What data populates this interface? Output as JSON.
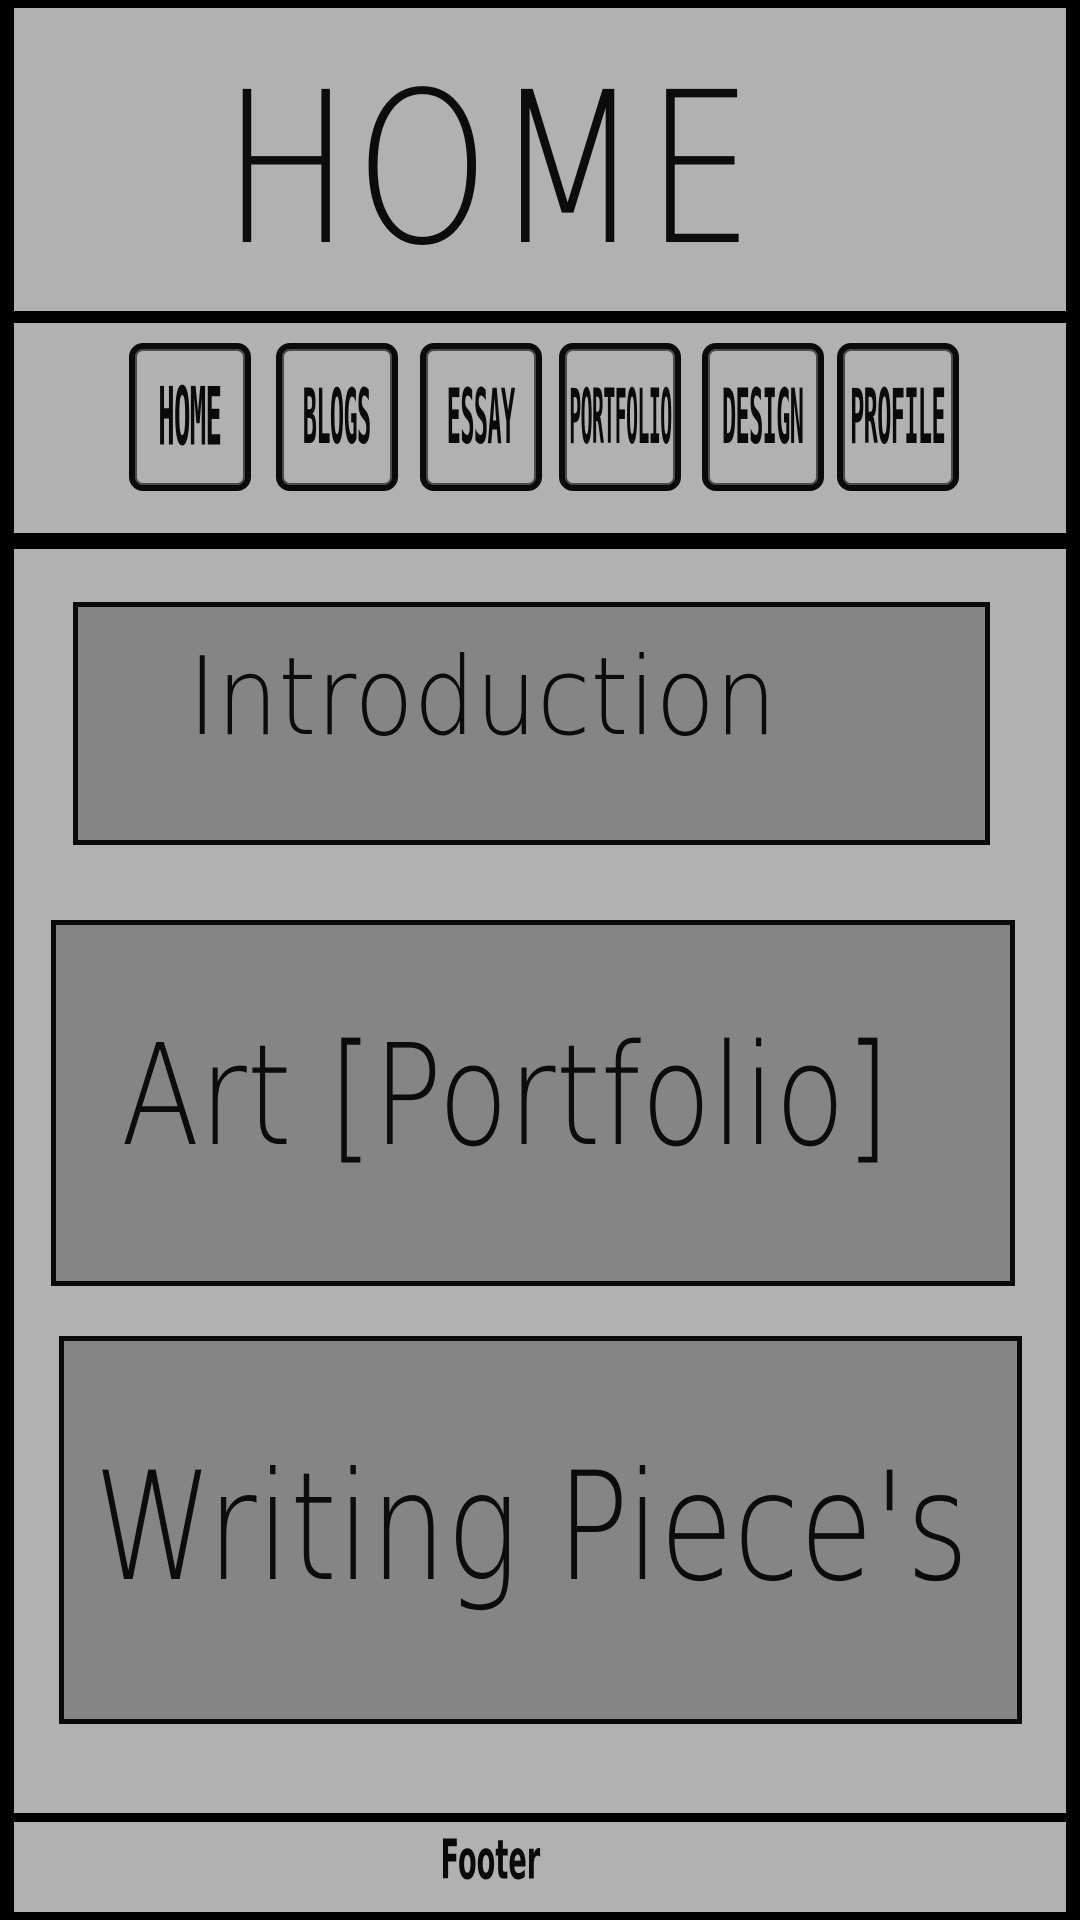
{
  "header": {
    "title": "HOME"
  },
  "nav": {
    "items": [
      {
        "label": "HOME"
      },
      {
        "label": "BLOGS"
      },
      {
        "label": "ESSAY"
      },
      {
        "label": "PORTFOLIO"
      },
      {
        "label": "DESIGN"
      },
      {
        "label": "PROFILE"
      }
    ]
  },
  "main": {
    "cards": [
      {
        "label": "Introduction"
      },
      {
        "label": "Art [Portfolio]"
      },
      {
        "label": "Writing Piece's"
      }
    ]
  },
  "footer": {
    "label": "Footer"
  },
  "colors": {
    "frame": "#000000",
    "panel": "#b1b1b1",
    "card": "#858585",
    "ink": "#0a0a0a"
  }
}
